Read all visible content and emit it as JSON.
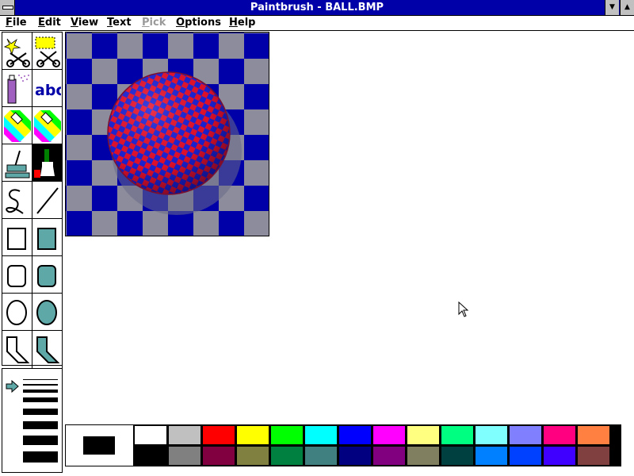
{
  "window": {
    "title": "Paintbrush - BALL.BMP",
    "minimize_glyph": "▼",
    "maximize_glyph": "▲",
    "system_menu_icon": "system-menu-icon"
  },
  "menubar": {
    "items": [
      {
        "label": "File",
        "enabled": true
      },
      {
        "label": "Edit",
        "enabled": true
      },
      {
        "label": "View",
        "enabled": true
      },
      {
        "label": "Text",
        "enabled": true
      },
      {
        "label": "Pick",
        "enabled": false
      },
      {
        "label": "Options",
        "enabled": true
      },
      {
        "label": "Help",
        "enabled": true
      }
    ]
  },
  "toolbox": {
    "tools": [
      {
        "name": "scissors-icon"
      },
      {
        "name": "pick-scissors-icon"
      },
      {
        "name": "airbrush-icon"
      },
      {
        "name": "text-icon",
        "text": "abc"
      },
      {
        "name": "color-eraser-icon"
      },
      {
        "name": "eraser-icon"
      },
      {
        "name": "paint-roller-icon"
      },
      {
        "name": "brush-icon",
        "selected": true
      },
      {
        "name": "curve-icon"
      },
      {
        "name": "line-icon"
      },
      {
        "name": "box-icon"
      },
      {
        "name": "filled-box-icon"
      },
      {
        "name": "rounded-box-icon"
      },
      {
        "name": "filled-rounded-box-icon"
      },
      {
        "name": "circle-icon"
      },
      {
        "name": "filled-circle-icon"
      },
      {
        "name": "polygon-icon"
      },
      {
        "name": "filled-polygon-icon"
      }
    ]
  },
  "linesize": {
    "selected_index": 0,
    "indicator_icon": "arrow-right-icon",
    "count": 8
  },
  "image": {
    "content": "checkered-ball-picture",
    "colors": {
      "blue": "#0000a8",
      "grey": "#8c8c9c",
      "red": "#e8102c"
    }
  },
  "palette": {
    "foreground": "#000000",
    "background": "#ffffff",
    "top_row": [
      "#ffffff",
      "#c0c0c0",
      "#ff0000",
      "#ffff00",
      "#00ff00",
      "#00ffff",
      "#0000ff",
      "#ff00ff",
      "#ffff80",
      "#00ff80",
      "#80ffff",
      "#8080ff",
      "#ff0080",
      "#ff8040"
    ],
    "bottom_row": [
      "#000000",
      "#808080",
      "#800040",
      "#808040",
      "#008040",
      "#408080",
      "#000080",
      "#800080",
      "#808060",
      "#004040",
      "#0080ff",
      "#0040ff",
      "#4000ff",
      "#804040"
    ]
  }
}
